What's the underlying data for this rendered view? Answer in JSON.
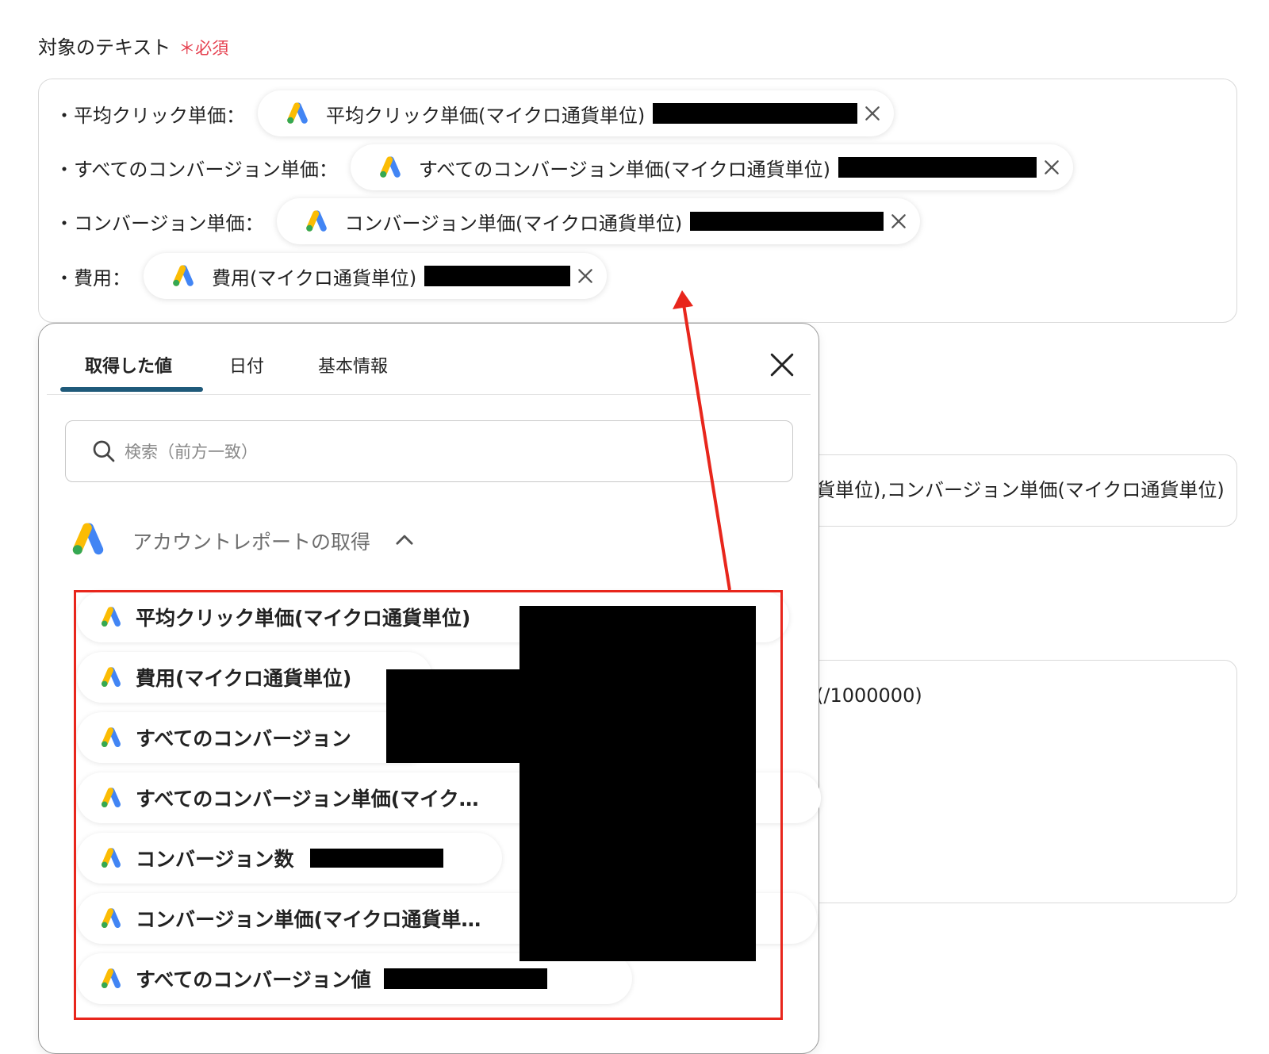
{
  "field": {
    "label": "対象のテキスト",
    "required_mark": "＊必須"
  },
  "textbox_lines": [
    {
      "prefix": "・平均クリック単価：",
      "chip": "平均クリック単価(マイクロ通貨単位)"
    },
    {
      "prefix": "・すべてのコンバージョン単価：",
      "chip": "すべてのコンバージョン単価(マイクロ通貨単位)"
    },
    {
      "prefix": "・コンバージョン単価：",
      "chip": "コンバージョン単価(マイクロ通貨単位)"
    },
    {
      "prefix": "・費用：",
      "chip": "費用(マイクロ通貨単位)"
    }
  ],
  "background_fields": {
    "field1_text": "貨単位),コンバージョン単価(マイクロ通貨単位)",
    "field2_text": "(/1000000)"
  },
  "popup": {
    "tabs": [
      {
        "label": "取得した値",
        "active": true
      },
      {
        "label": "日付",
        "active": false
      },
      {
        "label": "基本情報",
        "active": false
      }
    ],
    "search_placeholder": "検索（前方一致）",
    "section_title": "アカウントレポートの取得",
    "items": [
      "平均クリック単価(マイクロ通貨単位)",
      "費用(マイクロ通貨単位)",
      "すべてのコンバージョン",
      "すべてのコンバージョン単価(マイク…",
      "コンバージョン数",
      "コンバージョン単価(マイクロ通貨単…",
      "すべてのコンバージョン値"
    ]
  },
  "colors": {
    "required": "#e5404f",
    "tab_underline": "#1f5a7a",
    "highlight_border": "#e8261c",
    "arrow": "#e8261c",
    "ads_blue": "#4285f4",
    "ads_yellow": "#fbbc04",
    "ads_green": "#34a853"
  },
  "icons": {
    "chip_icon": "google-ads-icon",
    "remove_icon": "close-icon",
    "popup_close_icon": "close-icon",
    "search_icon": "search-icon",
    "collapse_icon": "chevron-up-icon"
  }
}
